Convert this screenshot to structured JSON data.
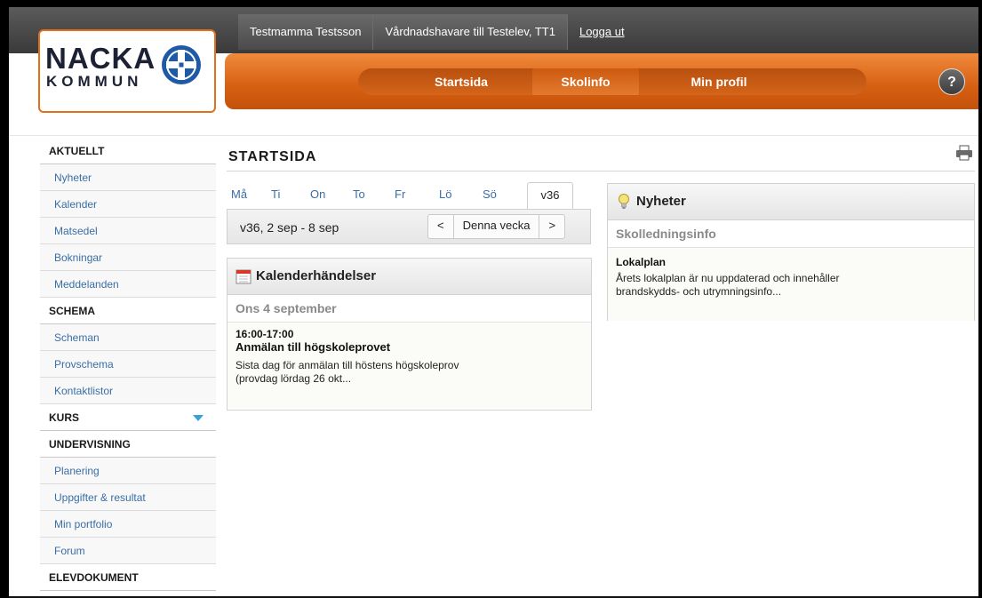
{
  "topbar": {
    "user_name": "Testmamma Testsson",
    "role": "Vårdnadshavare till Testelev, TT1",
    "logout": "Logga ut"
  },
  "logo": {
    "line1": "NACKA",
    "line2": "KOMMUN"
  },
  "nav": {
    "items": [
      {
        "label": "Startsida"
      },
      {
        "label": "Skolinfo"
      },
      {
        "label": "Min profil"
      }
    ],
    "help": "?"
  },
  "sidebar": {
    "sections": [
      {
        "heading": "AKTUELLT",
        "items": [
          "Nyheter",
          "Kalender",
          "Matsedel",
          "Bokningar",
          "Meddelanden"
        ]
      },
      {
        "heading": "SCHEMA",
        "items": [
          "Scheman",
          "Provschema",
          "Kontaktlistor"
        ]
      },
      {
        "heading": "KURS",
        "items": []
      },
      {
        "heading": "UNDERVISNING",
        "items": [
          "Planering",
          "Uppgifter & resultat",
          "Min portfolio",
          "Forum"
        ]
      },
      {
        "heading": "ELEVDOKUMENT",
        "items": []
      }
    ]
  },
  "main": {
    "title": "STARTSIDA",
    "days": [
      "Må",
      "Ti",
      "On",
      "To",
      "Fr",
      "Lö",
      "Sö"
    ],
    "week_tab": "v36",
    "week_range": "v36, 2 sep - 8 sep",
    "week_nav": {
      "prev": "<",
      "current": "Denna vecka",
      "next": ">"
    }
  },
  "calendar_panel": {
    "title": "Kalenderhändelser",
    "date": "Ons 4 september",
    "event": {
      "time": "16:00-17:00",
      "title": "Anmälan till högskoleprovet",
      "description_line1": "Sista dag för anmälan till höstens högskoleprov",
      "description_line2": "(provdag lördag 26 okt..."
    }
  },
  "news_panel": {
    "title": "Nyheter",
    "category": "Skolledningsinfo",
    "item": {
      "title": "Lokalplan",
      "text_line1": "Årets lokalplan är nu uppdaterad och innehåller",
      "text_line2": "brandskydds- och utrymningsinfo..."
    }
  },
  "colors": {
    "orange": "#d65f12",
    "link_blue": "#3a6ea5",
    "dark_bar": "#4a4a4a"
  }
}
